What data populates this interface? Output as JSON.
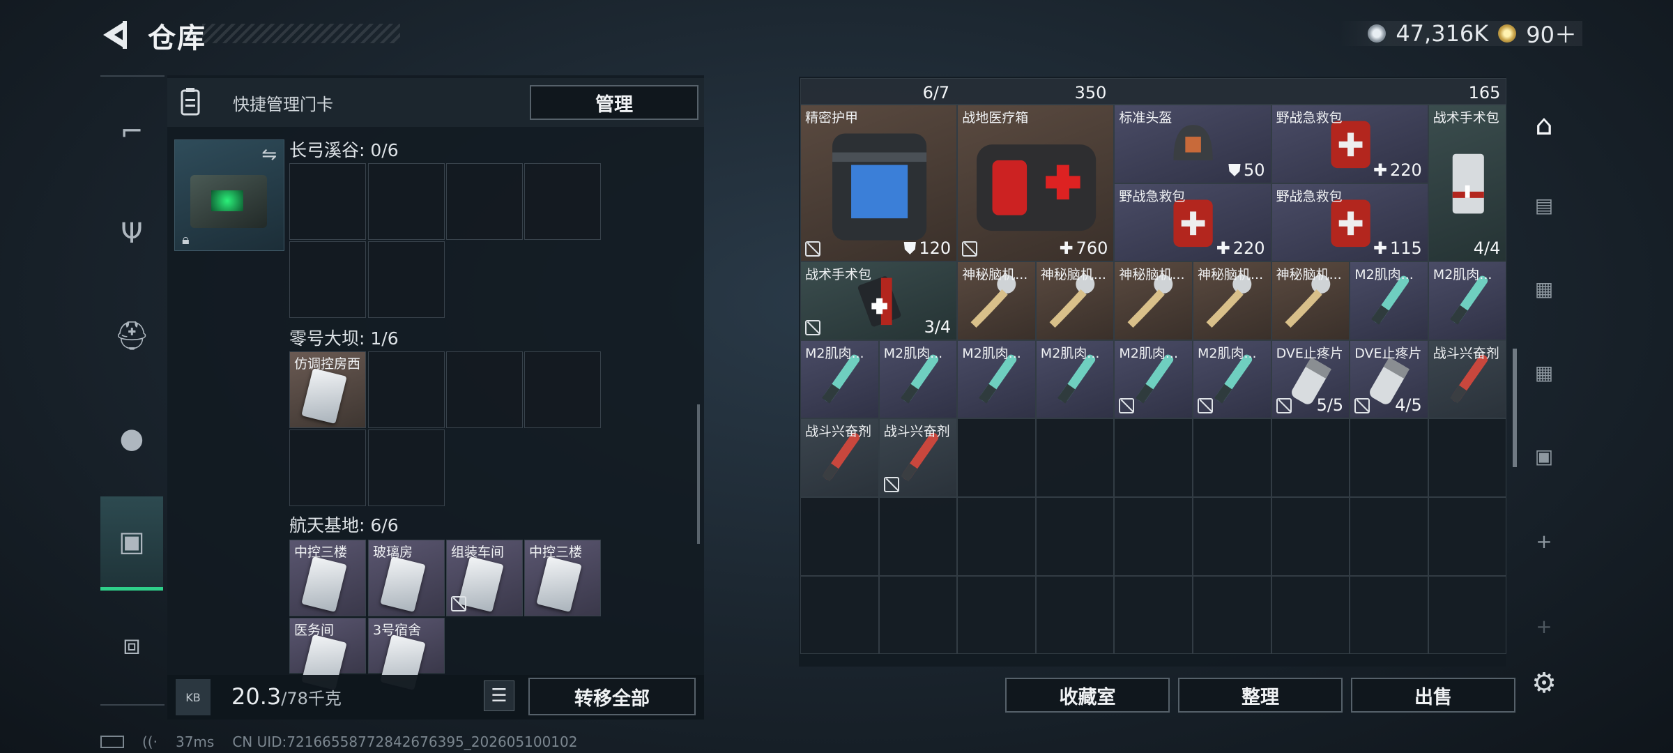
{
  "header": {
    "title": "仓库",
    "currency_silver": "47,316K",
    "currency_gold": "90＋"
  },
  "quick": {
    "label": "快捷管理门卡",
    "manage": "管理"
  },
  "sections": [
    {
      "title": "长弓溪谷: 0/6"
    },
    {
      "title": "零号大坝: 1/6",
      "item": "仿调控房西"
    },
    {
      "title": "航天基地: 6/6",
      "items": [
        "中控三楼",
        "玻璃房",
        "组装车间",
        "中控三楼",
        "医务间",
        "3号宿舍"
      ]
    }
  ],
  "bottom_left": {
    "weight": "20.3",
    "weight_max": "/78千克",
    "transfer": "转移全部",
    "bag_tag": "KB"
  },
  "status": {
    "ping": "37ms",
    "uid": "CN UID:72166558772842676395_202605100102"
  },
  "inventory": {
    "top_row": {
      "a": "6/7",
      "b": "350",
      "c": "165"
    },
    "items": [
      {
        "label": "精密护甲",
        "num": "120",
        "icon": "shield-icon"
      },
      {
        "label": "战地医疗箱",
        "num": "760",
        "icon": "plus-icon"
      },
      {
        "label": "标准头盔",
        "num": "50",
        "icon": "shield-icon"
      },
      {
        "label": "野战急救包",
        "num": "220",
        "icon": "plus-icon"
      },
      {
        "label": "战术手术包",
        "num": "4/4"
      },
      {
        "label": "野战急救包",
        "num": "220",
        "icon": "plus-icon"
      },
      {
        "label": "野战急救包",
        "num": "115",
        "icon": "plus-icon"
      },
      {
        "label": "战术手术包",
        "num": "3/4"
      },
      {
        "label": "神秘脑机..."
      },
      {
        "label": "神秘脑机..."
      },
      {
        "label": "神秘脑机..."
      },
      {
        "label": "神秘脑机..."
      },
      {
        "label": "神秘脑机..."
      },
      {
        "label": "M2肌肉..."
      },
      {
        "label": "M2肌肉..."
      },
      {
        "label": "M2肌肉..."
      },
      {
        "label": "M2肌肉..."
      },
      {
        "label": "M2肌肉..."
      },
      {
        "label": "M2肌肉..."
      },
      {
        "label": "M2肌肉..."
      },
      {
        "label": "M2肌肉..."
      },
      {
        "label": "DVE止疼片",
        "num": "5/5"
      },
      {
        "label": "DVE止疼片",
        "num": "4/5"
      },
      {
        "label": "战斗兴奋剂"
      },
      {
        "label": "战斗兴奋剂"
      },
      {
        "label": "战斗兴奋剂"
      }
    ],
    "buttons": {
      "collection": "收藏室",
      "sort": "整理",
      "sell": "出售"
    }
  },
  "colors": {
    "accent_green": "#2fd08a"
  }
}
